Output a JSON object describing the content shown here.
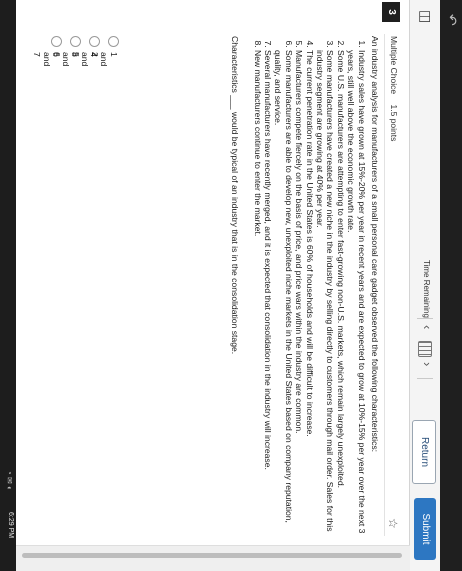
{
  "toolbar": {
    "time_remaining_label": "Time Remaining",
    "return_label": "Return",
    "submit_label": "Submit",
    "prev_glyph": "‹",
    "next_glyph": "›"
  },
  "question": {
    "number": "3",
    "type": "Multiple Choice",
    "points": "1.5 points",
    "intro": "An industry analysis for manufacturers of a small personal care gadget observed the following characteristics:",
    "items": [
      "Industry sales have grown at 15%-20% per year in recent years and are expected to grow at 10%-15% per year over the next 3 years, still well above the economic growth rate.",
      "Some U.S. manufacturers are attempting to enter fast-growing non-U.S. markets, which remain largely unexploited.",
      "Some manufacturers have created a new niche in the industry by selling directly to customers through mail order. Sales for this industry segment are growing at 40% per year.",
      "The current penetration rate in the United States is 60% of households and will be difficult to increase.",
      "Manufacturers compete fiercely on the basis of price, and price wars within the industry are common.",
      "Some manufacturers are able to develop new, unexploited niche markets in the United States based on company reputation, quality, and service.",
      "Several manufacturers have recently merged, and it is expected that consolidation in the industry will increase.",
      "New manufacturers continue to enter the market."
    ],
    "prompt": "Characteristics ___ would be typical of an industry that is in the consolidation stage.",
    "choices": [
      "1 and 4",
      "2 and 8",
      "5 and 6",
      "6 and 7"
    ]
  },
  "system": {
    "clock": "6:29 PM"
  },
  "colors": {
    "submit_bg": "#2d77c2",
    "return_text": "#2a4f7a",
    "topbar": "#1f1f1f"
  }
}
